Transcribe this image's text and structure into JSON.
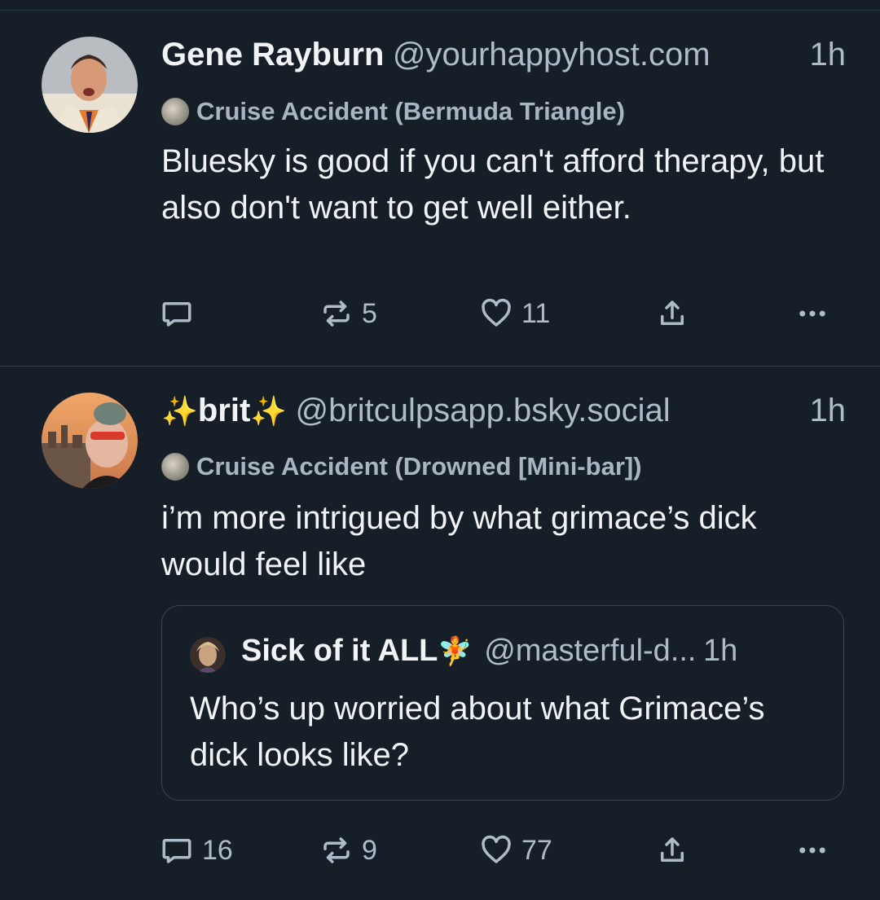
{
  "posts": [
    {
      "author_name": "Gene Rayburn",
      "handle": "@yourhappyhost.com",
      "time": "1h",
      "label": "Cruise Accident (Bermuda Triangle)",
      "text": "Bluesky is good if you can't afford therapy, but also don't want to get well either.",
      "reply_count": "",
      "repost_count": "5",
      "like_count": "11"
    },
    {
      "author_name_prefix": "✨",
      "author_name": "brit",
      "author_name_suffix": "✨",
      "handle": "@britculpsapp.bsky.social",
      "time": "1h",
      "label": "Cruise Accident (Drowned [Mini-bar])",
      "text": "i’m more intrigued by what grimace’s dick would feel like",
      "quote": {
        "author_name": "Sick of it ALL",
        "author_emoji": "🧚",
        "handle": "@masterful-d...",
        "time": "1h",
        "text": "Who’s up worried about what Grimace’s dick looks like?"
      },
      "reply_count": "16",
      "repost_count": "9",
      "like_count": "77"
    }
  ],
  "icons": {
    "reply": "speech-bubble-icon",
    "repost": "repost-arrows-icon",
    "like": "heart-icon",
    "share": "share-upload-icon",
    "more": "more-dots-icon",
    "label": "skull-badge-icon"
  },
  "colors": {
    "background": "#161e27",
    "text": "#f1f3f5",
    "muted": "#aebbc9",
    "divider": "#2e3a47"
  }
}
